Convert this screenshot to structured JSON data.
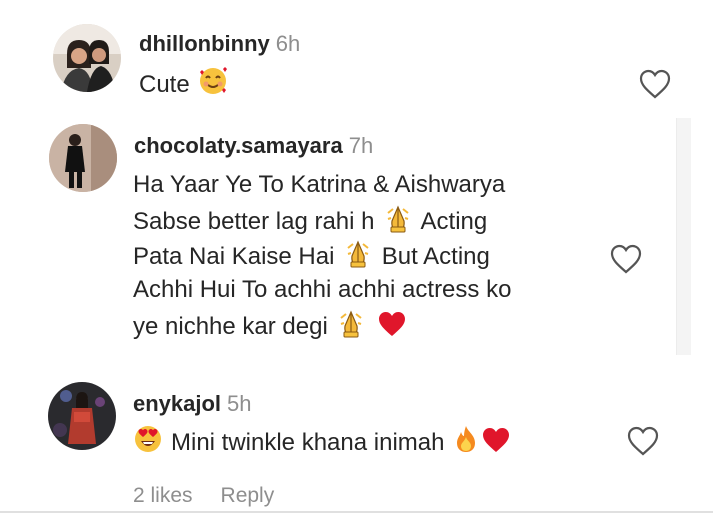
{
  "comments": [
    {
      "username": "dhillonbinny",
      "time": "6h",
      "lines": [
        "Cute"
      ]
    },
    {
      "username": "chocolaty.samayara",
      "time": "7h",
      "lines": [
        "Ha Yaar Ye To Katrina & Aishwarya",
        "Sabse better lag rahi h",
        "Acting",
        "Pata Nai Kaise Hai",
        "But Acting",
        "Achhi Hui To achhi achhi actress ko",
        "ye nichhe kar degi"
      ]
    },
    {
      "username": "enykajol",
      "time": "5h",
      "lines": [
        "Mini twinkle khana inimah"
      ],
      "likes": "2 likes",
      "reply": "Reply"
    }
  ],
  "icons": {
    "like": "heart-outline-icon",
    "emoji_smile_hearts": "smiling-face-with-hearts-icon",
    "emoji_praying": "folded-hands-icon",
    "emoji_red_heart": "red-heart-icon",
    "emoji_heart_eyes": "heart-eyes-icon",
    "emoji_fire": "fire-icon"
  },
  "colors": {
    "text": "#262626",
    "muted": "#8e8e8e",
    "heart_red": "#e0162b"
  }
}
